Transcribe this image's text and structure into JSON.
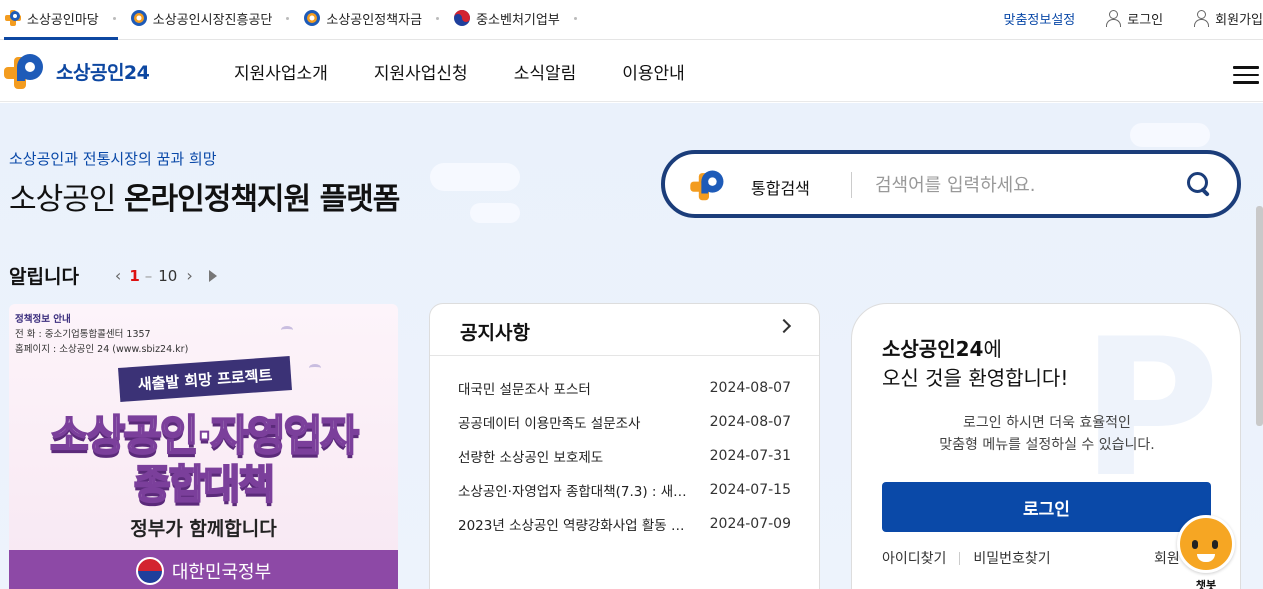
{
  "util_bar": {
    "links": [
      {
        "label": "소상공인마당",
        "icon": "plus-logo-icon"
      },
      {
        "label": "소상공인시장진흥공단",
        "icon": "semas-logo-icon"
      },
      {
        "label": "소상공인정책자금",
        "icon": "semas-logo-icon"
      },
      {
        "label": "중소벤처기업부",
        "icon": "taegeuk-icon"
      }
    ],
    "custom_info": "맞춤정보설정",
    "login": "로그인",
    "join": "회원가입"
  },
  "header": {
    "logo_text": "소상공인24",
    "menu": [
      "지원사업소개",
      "지원사업신청",
      "소식알림",
      "이용안내"
    ]
  },
  "hero": {
    "subtitle": "소상공인과 전통시장의 꿈과 희망",
    "title_plain": "소상공인 ",
    "title_bold": "온라인정책지원 플랫폼"
  },
  "search": {
    "label": "통합검색",
    "placeholder": "검색어를 입력하세요."
  },
  "notices_header": {
    "title": "알립니다",
    "current": "1",
    "sep": "–",
    "total": "10"
  },
  "banner": {
    "info_title": "정책정보 안내",
    "info_phone": "전    화 : 중소기업통합콜센터 1357",
    "info_web": "홈페이지 : 소상공인 24 (www.sbiz24.kr)",
    "ribbon": "새출발 희망 프로젝트",
    "main1": "소상공인·자영업자",
    "main2": "종합대책",
    "sub": "정부가 함께합니다",
    "footer": "대한민국정부"
  },
  "board": {
    "title": "공지사항",
    "items": [
      {
        "subject": "대국민 설문조사 포스터",
        "date": "2024-08-07"
      },
      {
        "subject": "공공데이터 이용만족도 설문조사",
        "date": "2024-08-07"
      },
      {
        "subject": "선량한 소상공인 보호제도",
        "date": "2024-07-31"
      },
      {
        "subject": "소상공인·자영업자 종합대책(7.3) : 새…",
        "date": "2024-07-15"
      },
      {
        "subject": "2023년 소상공인 역량강화사업 활동 …",
        "date": "2024-07-09"
      }
    ]
  },
  "login_card": {
    "brand": "소상공인24",
    "line1_suffix": "에",
    "line2": "오신 것을 환영합니다!",
    "desc1": "로그인 하시면 더욱 효율적인",
    "desc2": "맞춤형 메뉴를 설정하실 수 있습니다.",
    "button": "로그인",
    "find_id": "아이디찾기",
    "find_pw": "비밀번호찾기",
    "join": "회원"
  },
  "chatbot": {
    "label": "챗봇"
  },
  "colors": {
    "brand_blue": "#0a49a8",
    "brand_orange": "#f39c1f",
    "search_border": "#1b3d7a",
    "banner_purple": "#8d49a6"
  }
}
